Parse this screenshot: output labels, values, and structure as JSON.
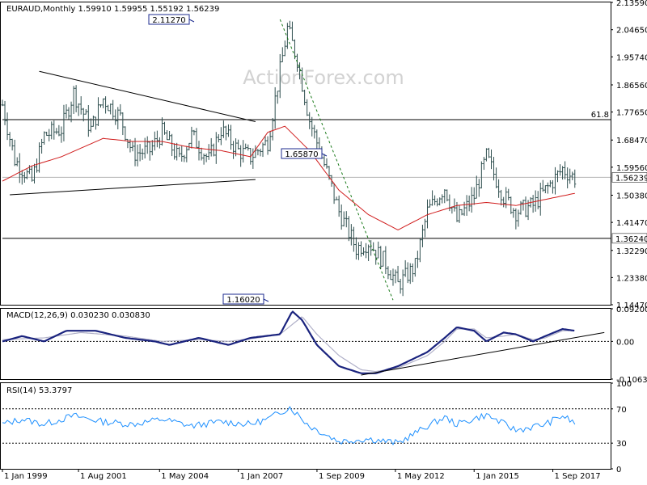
{
  "chart_data": [
    {
      "type": "candlestick",
      "panel": "price",
      "header": {
        "symbol": "EURAUD,Monthly",
        "open": "1.59910",
        "high": "1.59955",
        "low": "1.55192",
        "close": "1.56239"
      },
      "watermark": "ActionForex.com",
      "ylim": [
        1.1447,
        2.1359
      ],
      "y_ticks": [
        "2.13590",
        "2.04650",
        "1.95740",
        "1.86560",
        "1.77650",
        "1.68470",
        "1.59560",
        "1.50380",
        "1.41470",
        "1.32290",
        "1.23380",
        "1.14470"
      ],
      "x_ticks": [
        "1 Jan 1999",
        "1 Aug 2001",
        "1 May 2004",
        "1 Jan 2007",
        "1 Sep 2009",
        "1 May 2012",
        "1 Jan 2015",
        "1 Sep 2017"
      ],
      "current_price": {
        "label": "1.56239",
        "value": 1.56239
      },
      "horizontal_levels": [
        {
          "value": 1.3624,
          "label": "1.36240",
          "tag": ""
        },
        {
          "value": 1.7517,
          "label": "",
          "tag": "61.8"
        }
      ],
      "annotations": [
        {
          "label": "2.11270",
          "date": "2008-10",
          "value": 2.1127
        },
        {
          "label": "1.65870",
          "date": "2012-06",
          "value": 1.6587
        },
        {
          "label": "1.16020",
          "date": "2012-06",
          "value": 1.1602
        }
      ],
      "trendlines": [
        {
          "from": [
            "2000-04",
            1.91
          ],
          "to": [
            "2007-08",
            1.745
          ],
          "style": "solid"
        },
        {
          "from": [
            "1999-04",
            1.505
          ],
          "to": [
            "2007-08",
            1.555
          ],
          "style": "solid"
        },
        {
          "from": [
            "2008-06",
            2.08
          ],
          "to": [
            "2012-04",
            1.16
          ],
          "style": "dashed"
        }
      ],
      "moving_average_anchors": [
        [
          "1999-01",
          1.55
        ],
        [
          "2000-01",
          1.6
        ],
        [
          "2001-01",
          1.63
        ],
        [
          "2002-06",
          1.69
        ],
        [
          "2003-06",
          1.68
        ],
        [
          "2004-06",
          1.68
        ],
        [
          "2005-06",
          1.66
        ],
        [
          "2006-06",
          1.65
        ],
        [
          "2007-06",
          1.63
        ],
        [
          "2008-01",
          1.71
        ],
        [
          "2008-08",
          1.73
        ],
        [
          "2009-06",
          1.65
        ],
        [
          "2010-06",
          1.52
        ],
        [
          "2011-06",
          1.44
        ],
        [
          "2012-06",
          1.39
        ],
        [
          "2013-06",
          1.44
        ],
        [
          "2014-06",
          1.47
        ],
        [
          "2015-06",
          1.48
        ],
        [
          "2016-06",
          1.47
        ],
        [
          "2017-06",
          1.49
        ],
        [
          "2018-06",
          1.51
        ]
      ],
      "close_anchors": [
        [
          "1999-01",
          1.8
        ],
        [
          "1999-06",
          1.62
        ],
        [
          "2000-01",
          1.55
        ],
        [
          "2000-06",
          1.7
        ],
        [
          "2001-01",
          1.72
        ],
        [
          "2001-06",
          1.84
        ],
        [
          "2002-01",
          1.72
        ],
        [
          "2002-06",
          1.82
        ],
        [
          "2003-01",
          1.76
        ],
        [
          "2003-06",
          1.64
        ],
        [
          "2004-01",
          1.65
        ],
        [
          "2004-06",
          1.71
        ],
        [
          "2005-01",
          1.62
        ],
        [
          "2005-06",
          1.7
        ],
        [
          "2006-01",
          1.62
        ],
        [
          "2006-06",
          1.72
        ],
        [
          "2007-01",
          1.65
        ],
        [
          "2007-06",
          1.63
        ],
        [
          "2008-01",
          1.68
        ],
        [
          "2008-09",
          2.05
        ],
        [
          "2009-01",
          1.95
        ],
        [
          "2009-06",
          1.75
        ],
        [
          "2010-01",
          1.58
        ],
        [
          "2010-06",
          1.45
        ],
        [
          "2011-01",
          1.33
        ],
        [
          "2011-06",
          1.35
        ],
        [
          "2012-01",
          1.28
        ],
        [
          "2012-06",
          1.21
        ],
        [
          "2013-01",
          1.27
        ],
        [
          "2013-06",
          1.45
        ],
        [
          "2014-01",
          1.53
        ],
        [
          "2014-06",
          1.42
        ],
        [
          "2015-01",
          1.5
        ],
        [
          "2015-06",
          1.63
        ],
        [
          "2016-01",
          1.5
        ],
        [
          "2016-06",
          1.45
        ],
        [
          "2017-01",
          1.47
        ],
        [
          "2017-06",
          1.52
        ],
        [
          "2018-01",
          1.59
        ],
        [
          "2018-06",
          1.56
        ]
      ]
    },
    {
      "type": "line",
      "panel": "macd",
      "header": {
        "name": "MACD(12,26,9)",
        "macd": "0.030230",
        "signal": "0.030830"
      },
      "ylim": [
        -0.10638,
        0.092004
      ],
      "y_ticks": [
        "0.092004",
        "0.00",
        "-0.106308"
      ],
      "zero_line": 0,
      "macd_anchors": [
        [
          "1999-01",
          0.0
        ],
        [
          "1999-09",
          0.015
        ],
        [
          "2000-06",
          0.0
        ],
        [
          "2001-03",
          0.03
        ],
        [
          "2002-03",
          0.03
        ],
        [
          "2003-03",
          0.01
        ],
        [
          "2004-03",
          0.0
        ],
        [
          "2004-09",
          -0.01
        ],
        [
          "2005-09",
          0.01
        ],
        [
          "2006-09",
          -0.01
        ],
        [
          "2007-06",
          0.01
        ],
        [
          "2008-06",
          0.02
        ],
        [
          "2008-11",
          0.085
        ],
        [
          "2009-03",
          0.06
        ],
        [
          "2009-09",
          -0.01
        ],
        [
          "2010-06",
          -0.07
        ],
        [
          "2011-03",
          -0.09
        ],
        [
          "2011-09",
          -0.09
        ],
        [
          "2012-06",
          -0.07
        ],
        [
          "2013-06",
          -0.03
        ],
        [
          "2014-01",
          0.01
        ],
        [
          "2014-06",
          0.04
        ],
        [
          "2015-01",
          0.03
        ],
        [
          "2015-06",
          0.0
        ],
        [
          "2016-01",
          0.025
        ],
        [
          "2016-06",
          0.02
        ],
        [
          "2017-01",
          0.0
        ],
        [
          "2017-06",
          0.015
        ],
        [
          "2018-01",
          0.035
        ],
        [
          "2018-06",
          0.03
        ]
      ],
      "signal_anchors": [
        [
          "1999-01",
          0.005
        ],
        [
          "2000-06",
          0.01
        ],
        [
          "2001-09",
          0.025
        ],
        [
          "2003-03",
          0.015
        ],
        [
          "2004-06",
          0.0
        ],
        [
          "2005-09",
          0.005
        ],
        [
          "2006-09",
          0.0
        ],
        [
          "2007-09",
          0.01
        ],
        [
          "2008-06",
          0.02
        ],
        [
          "2009-03",
          0.07
        ],
        [
          "2009-09",
          0.02
        ],
        [
          "2010-06",
          -0.04
        ],
        [
          "2011-03",
          -0.08
        ],
        [
          "2011-09",
          -0.085
        ],
        [
          "2012-06",
          -0.075
        ],
        [
          "2013-06",
          -0.04
        ],
        [
          "2014-01",
          0.0
        ],
        [
          "2014-06",
          0.035
        ],
        [
          "2015-01",
          0.035
        ],
        [
          "2015-06",
          0.01
        ],
        [
          "2016-01",
          0.015
        ],
        [
          "2016-06",
          0.02
        ],
        [
          "2017-01",
          0.005
        ],
        [
          "2017-06",
          0.01
        ],
        [
          "2018-01",
          0.03
        ],
        [
          "2018-06",
          0.031
        ]
      ],
      "trendline": {
        "from": [
          "2011-03",
          -0.095
        ],
        "to": [
          "2019-06",
          0.025
        ]
      }
    },
    {
      "type": "line",
      "panel": "rsi",
      "header": {
        "name": "RSI(14)",
        "value": "53.3797"
      },
      "ylim": [
        0,
        100
      ],
      "y_ticks": [
        "100",
        "70",
        "30",
        "0"
      ],
      "levels": [
        70,
        30
      ],
      "rsi_anchors": [
        [
          "1999-01",
          52
        ],
        [
          "1999-09",
          58
        ],
        [
          "2000-06",
          52
        ],
        [
          "2001-06",
          62
        ],
        [
          "2002-06",
          55
        ],
        [
          "2003-06",
          52
        ],
        [
          "2004-06",
          58
        ],
        [
          "2005-06",
          50
        ],
        [
          "2006-06",
          55
        ],
        [
          "2007-06",
          52
        ],
        [
          "2008-01",
          58
        ],
        [
          "2008-10",
          72
        ],
        [
          "2009-06",
          50
        ],
        [
          "2010-06",
          32
        ],
        [
          "2011-06",
          35
        ],
        [
          "2012-06",
          30
        ],
        [
          "2013-06",
          50
        ],
        [
          "2014-01",
          60
        ],
        [
          "2014-06",
          52
        ],
        [
          "2015-06",
          63
        ],
        [
          "2016-06",
          45
        ],
        [
          "2017-06",
          52
        ],
        [
          "2018-01",
          62
        ],
        [
          "2018-06",
          53
        ]
      ]
    }
  ]
}
